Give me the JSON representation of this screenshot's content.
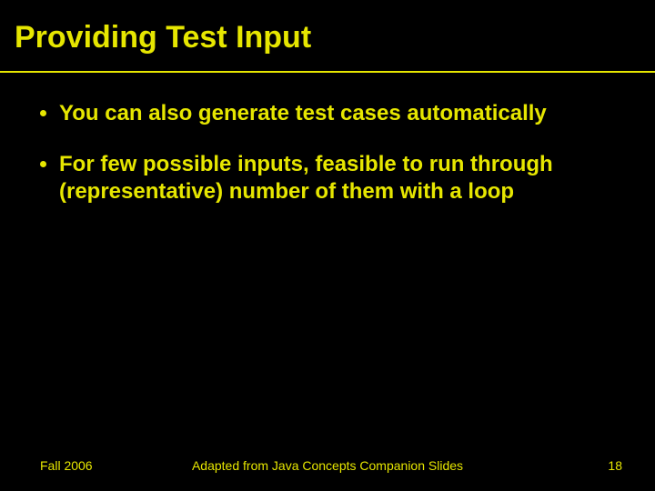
{
  "slide": {
    "title": "Providing Test Input",
    "bullets": [
      "You can also generate test cases automatically",
      "For few possible inputs, feasible to run through (representative) number of them with a loop"
    ],
    "footer": {
      "left": "Fall 2006",
      "center": "Adapted from Java Concepts Companion Slides",
      "page": "18"
    }
  }
}
